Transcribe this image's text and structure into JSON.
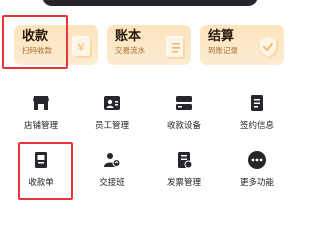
{
  "top_cards": [
    {
      "title": "收款",
      "subtitle": "扫码收款",
      "icon": "yuan-coin-icon"
    },
    {
      "title": "账本",
      "subtitle": "交易流水",
      "icon": "ledger-icon"
    },
    {
      "title": "结算",
      "subtitle": "到账记录",
      "icon": "checkmark-shield-icon"
    }
  ],
  "grid": [
    {
      "label": "店铺管理",
      "icon": "store-icon"
    },
    {
      "label": "员工管理",
      "icon": "employee-card-icon"
    },
    {
      "label": "收款设备",
      "icon": "device-icon"
    },
    {
      "label": "签约信息",
      "icon": "contract-doc-icon"
    },
    {
      "label": "收款单",
      "icon": "receipt-icon"
    },
    {
      "label": "交接班",
      "icon": "shift-handover-icon"
    },
    {
      "label": "发票管理",
      "icon": "invoice-icon"
    },
    {
      "label": "更多功能",
      "icon": "more-icon"
    }
  ],
  "colors": {
    "accent_red": "#e8353b",
    "card_text": "#2a1a0c",
    "card_subtext": "#a96a2e",
    "icon_dark": "#26262b"
  }
}
